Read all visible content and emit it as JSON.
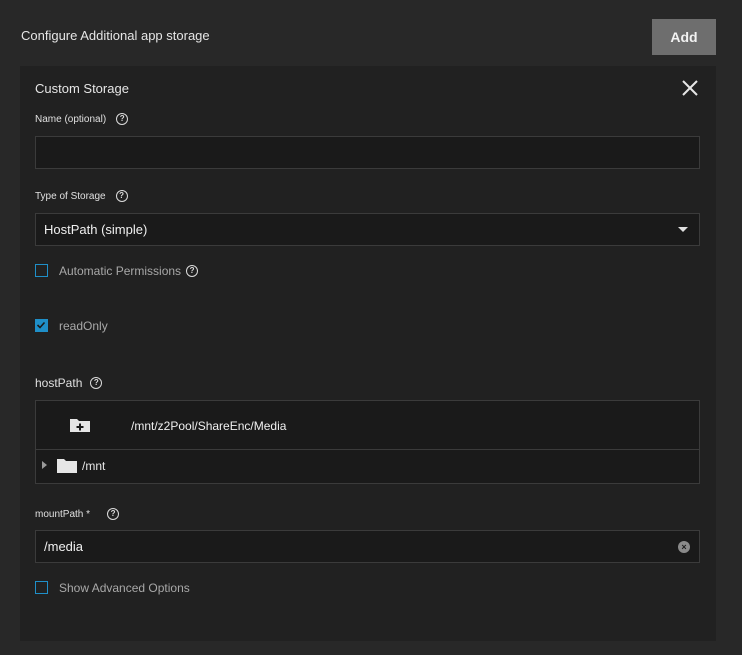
{
  "header": {
    "title": "Configure Additional app storage",
    "add_label": "Add"
  },
  "card": {
    "title": "Custom Storage",
    "name_field": {
      "label": "Name (optional)",
      "value": ""
    },
    "storage_type": {
      "label": "Type of Storage",
      "value": "HostPath (simple)"
    },
    "auto_permissions": {
      "label": "Automatic Permissions",
      "checked": false
    },
    "read_only": {
      "label": "readOnly",
      "checked": true
    },
    "host_path": {
      "label": "hostPath",
      "selected_path": "/mnt/z2Pool/ShareEnc/Media",
      "tree": [
        {
          "label": "/mnt",
          "expanded": false
        }
      ]
    },
    "mount_path": {
      "label": "mountPath *",
      "value": "/media"
    },
    "advanced_options": {
      "label": "Show Advanced Options",
      "checked": false
    }
  },
  "colors": {
    "accent": "#1f8fc8",
    "background": "#282828",
    "card": "#212121"
  },
  "icons": [
    "help-icon",
    "close-icon",
    "new-folder-icon",
    "folder-icon",
    "clear-icon",
    "dropdown-caret-icon",
    "check-icon"
  ]
}
